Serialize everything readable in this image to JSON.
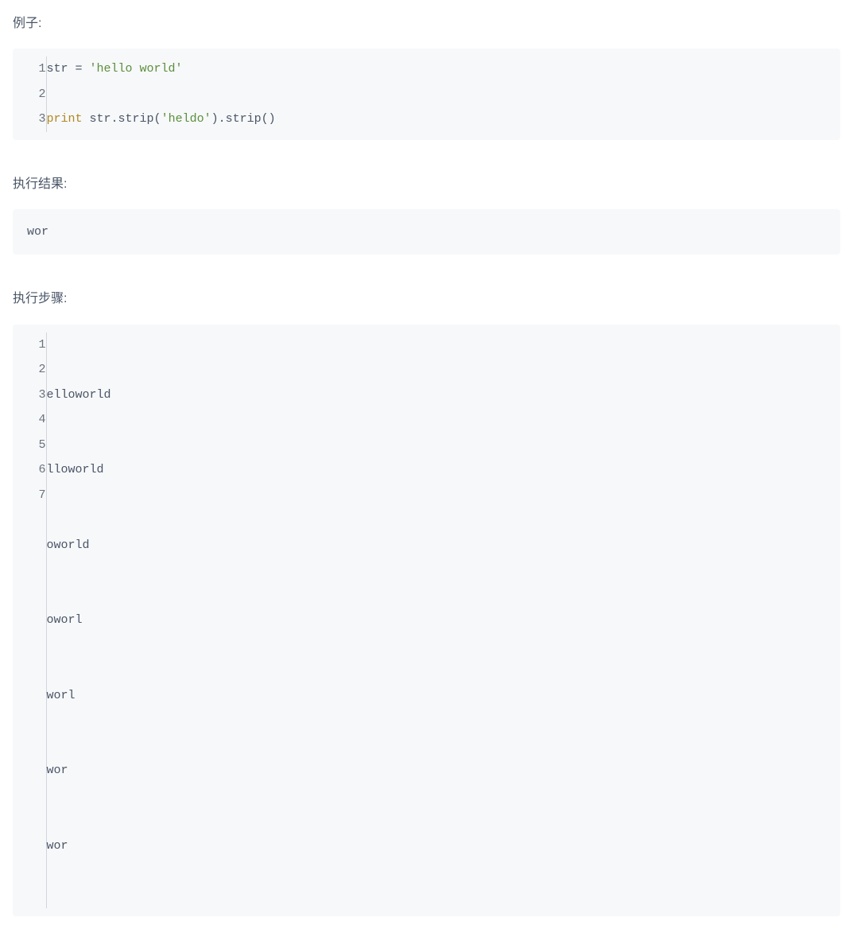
{
  "labels": {
    "example": "例子:",
    "result": "执行结果:",
    "steps": "执行步骤:"
  },
  "code1": {
    "lines": [
      "1",
      "2",
      "3"
    ],
    "line1_str": "str",
    "line1_eq": " = ",
    "line1_val": "'hello world'",
    "line3_print": "print",
    "line3_sp": " ",
    "line3_str": "str",
    "line3_dot1": ".strip(",
    "line3_arg": "'heldo'",
    "line3_dot2": ").strip()"
  },
  "output": "wor",
  "code2": {
    "lines": [
      "1",
      "2",
      "3",
      "4",
      "5",
      "6",
      "7"
    ],
    "content": [
      "elloworld",
      "lloworld",
      "oworld",
      "oworl",
      "worl",
      "wor",
      "wor"
    ]
  }
}
